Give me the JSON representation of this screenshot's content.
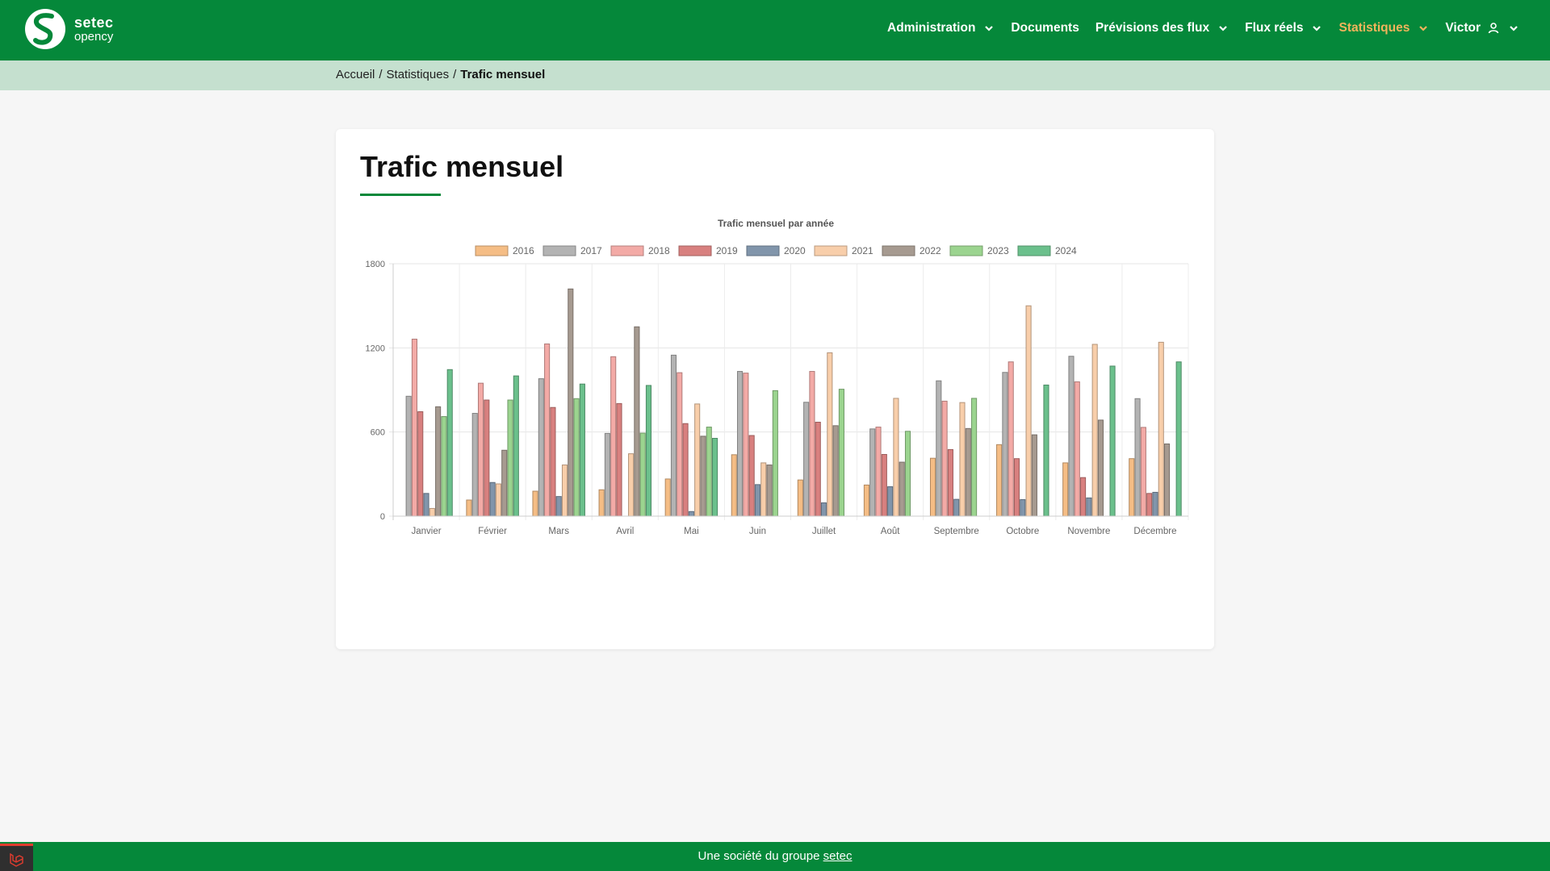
{
  "brand": {
    "line1": "setec",
    "line2": "opency"
  },
  "nav": {
    "items": [
      {
        "label": "Administration",
        "dropdown": true,
        "active": false
      },
      {
        "label": "Documents",
        "dropdown": false,
        "active": false
      },
      {
        "label": "Prévisions des flux",
        "dropdown": true,
        "active": false
      },
      {
        "label": "Flux réels",
        "dropdown": true,
        "active": false
      },
      {
        "label": "Statistiques",
        "dropdown": true,
        "active": true
      },
      {
        "label": "Victor",
        "dropdown": true,
        "active": false,
        "icon": "user-icon"
      }
    ]
  },
  "breadcrumb": {
    "home": "Accueil",
    "section": "Statistiques",
    "current": "Trafic mensuel",
    "separator": "/"
  },
  "page": {
    "title": "Trafic mensuel"
  },
  "footer": {
    "text": "Une société du groupe",
    "link": "setec"
  },
  "colors": {
    "brand": "#05883a",
    "active_nav": "#f2b45c",
    "breadcrumb_bg": "#c5e0cf"
  },
  "chart_data": {
    "type": "bar",
    "title": "Trafic mensuel par année",
    "legend_position": "top",
    "grid": true,
    "categories": [
      "Janvier",
      "Février",
      "Mars",
      "Avril",
      "Mai",
      "Juin",
      "Juillet",
      "Août",
      "Septembre",
      "Octobre",
      "Novembre",
      "Décembre"
    ],
    "ylim": [
      0,
      1800
    ],
    "yticks": [
      0,
      600,
      1200,
      1800
    ],
    "series": [
      {
        "name": "2016",
        "color": "#f5bd85",
        "values": [
          0,
          115,
          178,
          188,
          265,
          438,
          258,
          222,
          413,
          510,
          380,
          410
        ]
      },
      {
        "name": "2017",
        "color": "#b3b3b3",
        "values": [
          855,
          733,
          980,
          590,
          1148,
          1032,
          812,
          622,
          965,
          1025,
          1140,
          838
        ]
      },
      {
        "name": "2018",
        "color": "#f3aaa6",
        "values": [
          1262,
          948,
          1228,
          1137,
          1023,
          1020,
          1032,
          635,
          820,
          1100,
          958,
          633
        ]
      },
      {
        "name": "2019",
        "color": "#d8807f",
        "values": [
          745,
          828,
          775,
          803,
          660,
          575,
          670,
          440,
          475,
          410,
          275,
          162
        ]
      },
      {
        "name": "2020",
        "color": "#8195ab",
        "values": [
          162,
          240,
          140,
          0,
          33,
          225,
          95,
          210,
          120,
          118,
          130,
          170
        ]
      },
      {
        "name": "2021",
        "color": "#f8ceaa",
        "values": [
          55,
          230,
          365,
          445,
          800,
          380,
          1165,
          840,
          810,
          1500,
          1225,
          1240
        ]
      },
      {
        "name": "2022",
        "color": "#a69a90",
        "values": [
          780,
          470,
          1620,
          1350,
          570,
          365,
          645,
          385,
          625,
          580,
          685,
          515
        ]
      },
      {
        "name": "2023",
        "color": "#9bd48f",
        "values": [
          710,
          828,
          838,
          592,
          635,
          895,
          905,
          605,
          840,
          0,
          0,
          0
        ]
      },
      {
        "name": "2024",
        "color": "#6bc08c",
        "values": [
          1045,
          1000,
          942,
          932,
          555,
          0,
          0,
          0,
          0,
          935,
          1070,
          1100
        ]
      }
    ]
  }
}
